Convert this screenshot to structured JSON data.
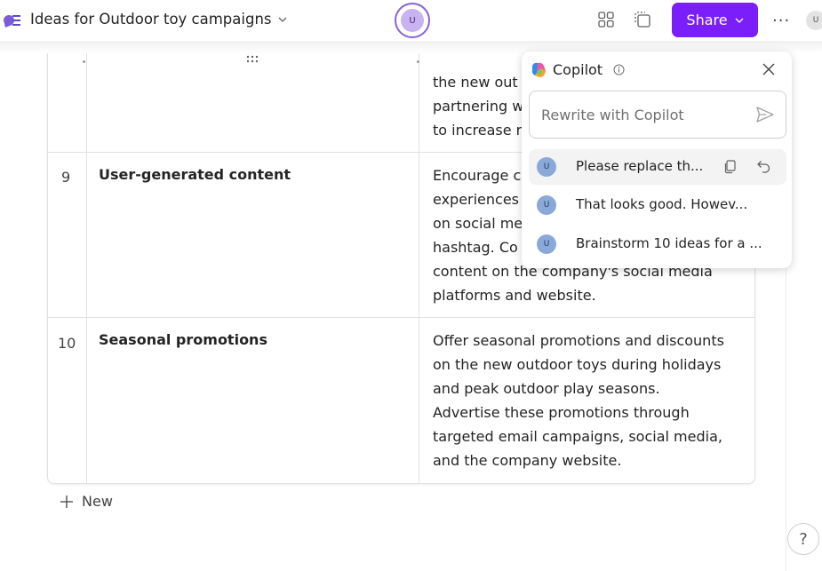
{
  "header": {
    "doc_title": "Ideas for Outdoor toy campaigns",
    "center_avatar_initial": "U",
    "share_label": "Share",
    "more_label": "···",
    "right_avatar_initial": "U"
  },
  "table": {
    "partial_row": {
      "desc_lines": [
        "the new out",
        "partnering w",
        "to increase r"
      ]
    },
    "rows": [
      {
        "number": "9",
        "title": "User-generated content",
        "desc_lines": [
          "Encourage c",
          "experiences",
          "on social me",
          "hashtag. Co",
          "content on the company's social media",
          "platforms and website."
        ]
      },
      {
        "number": "10",
        "title": "Seasonal promotions",
        "desc_lines": [
          "Offer seasonal promotions and discounts",
          "on the new outdoor toys during holidays",
          "and peak outdoor play seasons.",
          "Advertise these promotions through",
          "targeted email campaigns, social media,",
          "and the company website."
        ]
      }
    ],
    "new_label": "New"
  },
  "copilot": {
    "title": "Copilot",
    "input_placeholder": "Rewrite with Copilot",
    "history": [
      {
        "avatar": "U",
        "text": "Please replace th..."
      },
      {
        "avatar": "U",
        "text": "That looks good. Howev..."
      },
      {
        "avatar": "U",
        "text": "Brainstorm 10 ideas for a ..."
      }
    ]
  },
  "help_label": "?",
  "colors": {
    "accent": "#7a1ffa",
    "avatar_ring": "#8a60d8",
    "history_avatar": "#8aa9d8"
  }
}
